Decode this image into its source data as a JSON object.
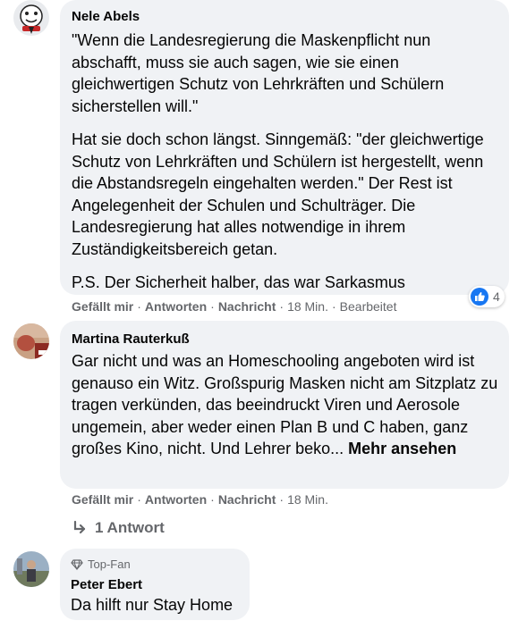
{
  "comments": [
    {
      "author": "Nele Abels",
      "paragraphs": [
        "\"Wenn die Landesregierung die Maskenpflicht nun abschafft, muss sie auch sagen, wie sie einen gleichwertigen Schutz von Lehrkräften und Schülern sicherstellen will.\"",
        "Hat sie doch schon längst. Sinngemäß: \"der gleichwertige Schutz von Lehrkräften und Schülern ist hergestellt, wenn die Abstandsregeln eingehalten werden.\" Der Rest ist Angelegenheit der Schulen und Schulträger. Die Landesregierung hat alles notwendige in ihrem Zuständigkeitsbereich getan.",
        "P.S. Der Sicherheit halber, das war Sarkasmus"
      ],
      "actions": {
        "like": "Gefällt mir",
        "reply": "Antworten",
        "message": "Nachricht",
        "time": "18 Min.",
        "edited": "Bearbeitet"
      },
      "reaction_count": "4"
    },
    {
      "author": "Martina Rauterkuß",
      "text": "Gar nicht und was an Homeschooling angeboten wird ist genauso ein Witz. Großspurig Masken nicht am Sitzplatz zu tragen verkünden, das beeindruckt Viren und Aerosole ungemein, aber weder einen Plan B und C haben, ganz großes Kino, nicht. Und Lehrer beko... ",
      "more": "Mehr ansehen",
      "actions": {
        "like": "Gefällt mir",
        "reply": "Antworten",
        "message": "Nachricht",
        "time": "18 Min."
      },
      "replies_label": "1 Antwort"
    },
    {
      "badge": "Top-Fan",
      "author": "Peter Ebert",
      "text": "Da hilft nur Stay Home"
    }
  ],
  "colors": {
    "bubble": "#f0f2f5",
    "meta": "#65676b",
    "like_blue": "#1877f2"
  }
}
